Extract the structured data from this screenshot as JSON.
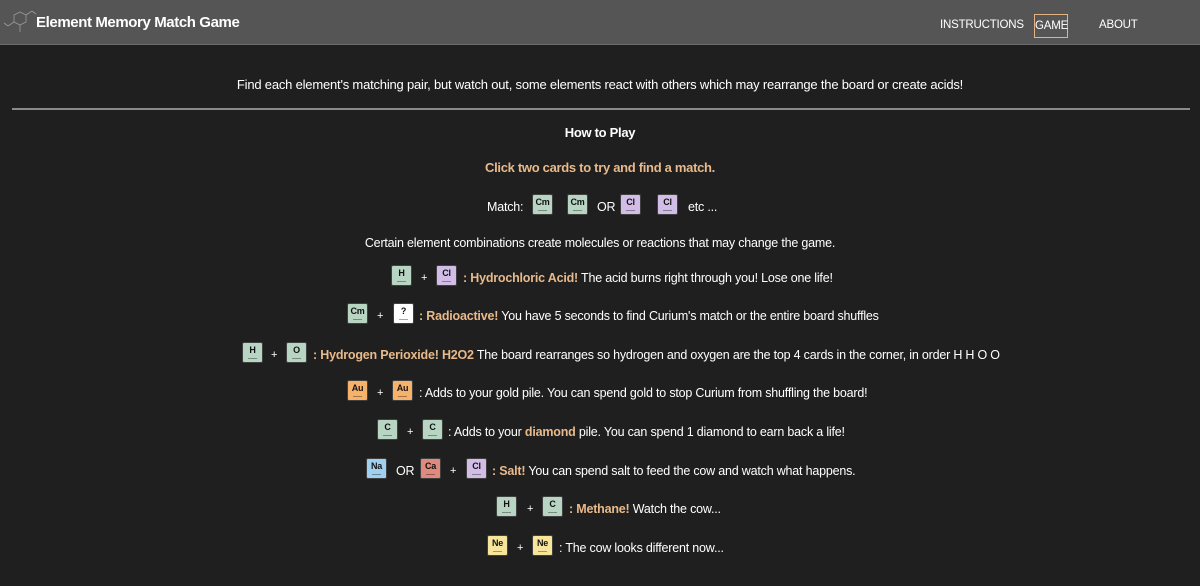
{
  "colors": {
    "background": "#1f1f1f",
    "navbar": "#555555",
    "highlight": "#e8b98a",
    "active_nav_border": "#e4b383",
    "card_green": "#b8d4c2",
    "card_purple": "#d2bde6",
    "card_orange": "#f6b26b",
    "card_blue": "#9fd0ef",
    "card_red": "#e08a7e",
    "card_yellow": "#f6e59a",
    "card_white": "#ffffff"
  },
  "nav": {
    "brand": "Element Memory Match Game",
    "logo_icon": "molecule-icon",
    "items": [
      {
        "label": "INSTRUCTIONS",
        "active": false
      },
      {
        "label": "GAME",
        "active": true
      },
      {
        "label": "ABOUT",
        "active": false
      }
    ]
  },
  "intro": "Find each element's matching pair, but watch out, some elements react with others which may rearrange the board or create acids!",
  "how_to_play": {
    "title": "How to Play",
    "click_hint": "Click two cards to try and find a match.",
    "match_row": {
      "label": "Match:",
      "cards": [
        "Cm",
        "Cm",
        "Cl",
        "Cl"
      ],
      "or": "OR",
      "etc": "etc ..."
    },
    "combos_note": "Certain element combinations create molecules or reactions that may change the game.",
    "rules": [
      {
        "cards": [
          "H",
          "Cl"
        ],
        "plus": "+",
        "name": ": Hydrochloric Acid!",
        "desc": " The acid burns right through you! Lose one life!"
      },
      {
        "cards": [
          "Cm",
          "?"
        ],
        "plus": "+",
        "name": ": Radioactive!",
        "desc": " You have 5 seconds to find Curium's match or the entire board shuffles"
      },
      {
        "cards": [
          "H",
          "O"
        ],
        "plus": "+",
        "name": ": Hydrogen Perioxide! H2O2",
        "desc": " The board rearranges so hydrogen and oxygen are the top 4 cards in the corner, in order H H O O"
      },
      {
        "cards": [
          "Au",
          "Au"
        ],
        "plus": "+",
        "name": "",
        "desc": ": Adds to your gold pile. You can spend gold to stop Curium from shuffling the board!"
      },
      {
        "cards": [
          "C",
          "C"
        ],
        "plus": "+",
        "pre": ": Adds to your ",
        "name": "diamond",
        "desc": " pile. You can spend 1 diamond to earn back a life!"
      },
      {
        "cards": [
          "Na",
          "Ca",
          "Cl"
        ],
        "or": "OR",
        "plus": "+",
        "name": ": Salt!",
        "desc": " You can spend salt to feed the cow and watch what happens."
      },
      {
        "cards": [
          "H",
          "C"
        ],
        "plus": "+",
        "name": ": Methane!",
        "desc": " Watch the cow..."
      },
      {
        "cards": [
          "Ne",
          "Ne"
        ],
        "plus": "+",
        "name": "",
        "desc": ": The cow looks different now..."
      }
    ]
  }
}
